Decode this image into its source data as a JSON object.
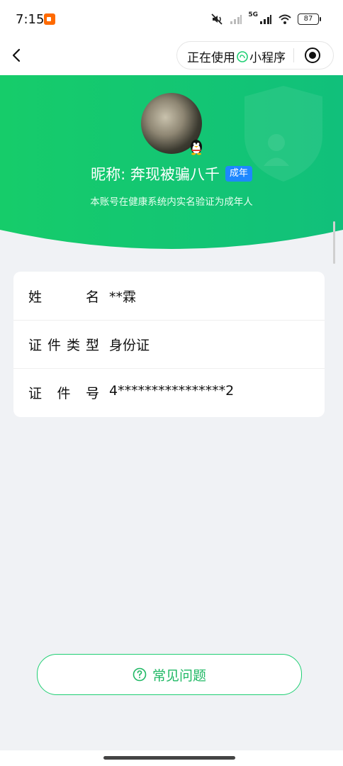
{
  "status_bar": {
    "time": "7:15",
    "battery": "87",
    "network": "5G"
  },
  "nav": {
    "capsule_label": "正在使用",
    "capsule_program": "小程序"
  },
  "profile": {
    "nickname_label": "昵称: 奔现被骗八千",
    "age_tag": "成年",
    "subtitle": "本账号在健康系统内实名验证为成年人"
  },
  "info": {
    "rows": [
      {
        "label_chars": [
          "姓",
          "名"
        ],
        "value": "**霖"
      },
      {
        "label_chars": [
          "证",
          "件",
          "类",
          "型"
        ],
        "value": "身份证"
      },
      {
        "label_chars": [
          "证",
          "件",
          "号"
        ],
        "value": "4****************2"
      }
    ],
    "colon": ":"
  },
  "faq": {
    "label": "常见问题"
  },
  "colors": {
    "accent": "#1fcf73",
    "tag": "#1e88ff"
  }
}
